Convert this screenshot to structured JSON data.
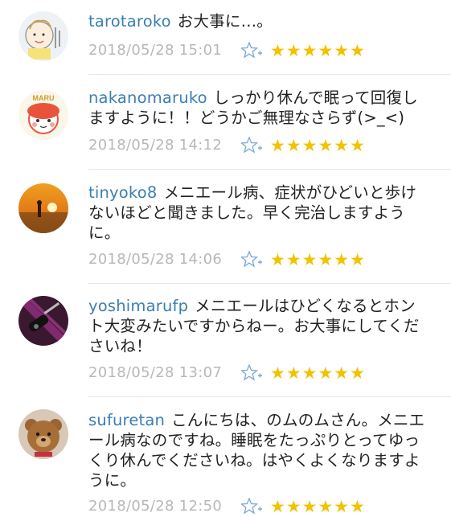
{
  "comments": [
    {
      "username": "tarotaroko",
      "text": "お大事に…。",
      "timestamp": "2018/05/28 15:01",
      "stars": "★★★★★★",
      "avatar_icon": "baby-drawing-avatar"
    },
    {
      "username": "nakanomaruko",
      "text": "しっかり休んで眠って回復しますように！！どうかご無理なさらず(>_<)",
      "timestamp": "2018/05/28 14:12",
      "stars": "★★★★★★",
      "avatar_icon": "maru-character-avatar",
      "avatar_text": "MARU"
    },
    {
      "username": "tinyoko8",
      "text": "メニエール病、症状がひどいと歩けないほどと聞きました。早く完治しますように。",
      "timestamp": "2018/05/28 14:06",
      "stars": "★★★★★★",
      "avatar_icon": "sunset-beach-avatar"
    },
    {
      "username": "yoshimarufp",
      "text": "メニエールはひどくなるとホント大変みたいですからねー。お大事にしてくださいね！",
      "timestamp": "2018/05/28 13:07",
      "stars": "★★★★★★",
      "avatar_icon": "guitar-avatar"
    },
    {
      "username": "sufuretan",
      "text": "こんにちは、のムのムさん。メニエール病なのですね。睡眠をたっぷりとってゆっくり休んでくださいね。はやくよくなりますように。",
      "timestamp": "2018/05/28 12:50",
      "stars": "★★★★★★",
      "avatar_icon": "teddy-bear-avatar"
    }
  ],
  "colors": {
    "username": "#3a7fb0",
    "timestamp": "#b8b8b8",
    "star_filled": "#f2c200",
    "star_add_outline": "#7aa7d8"
  }
}
